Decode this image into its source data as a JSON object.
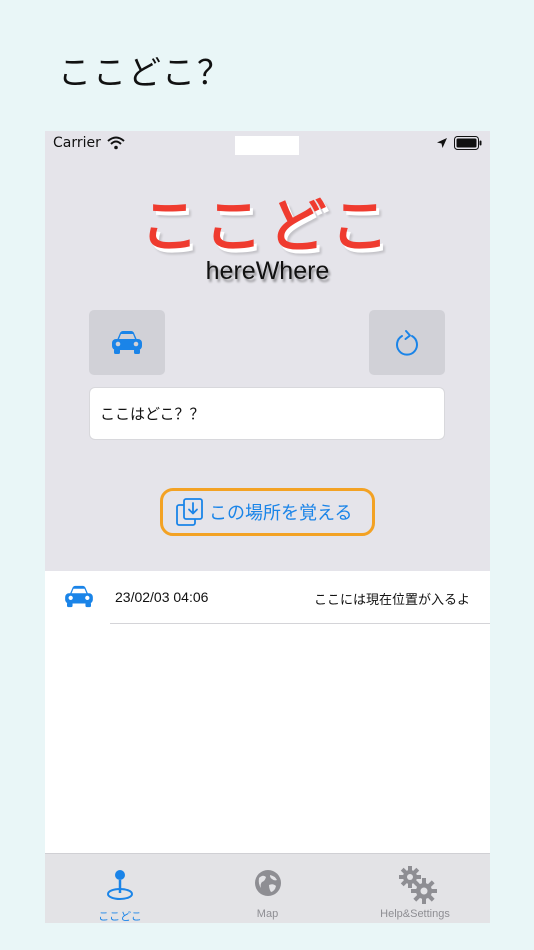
{
  "caption": "ここどこ？",
  "status_bar": {
    "carrier": "Carrier"
  },
  "app": {
    "logo": "ここどこ",
    "subtitle": "hereWhere"
  },
  "location_field": {
    "value": "ここはどこ？？"
  },
  "remember_button": {
    "label": "この場所を覚える"
  },
  "history": [
    {
      "date": "23/02/03 04:06",
      "note": "ここには現在位置が入るよ"
    }
  ],
  "tabs": [
    {
      "label": "ここどこ",
      "active": true
    },
    {
      "label": "Map",
      "active": false
    },
    {
      "label": "Help&Settings",
      "active": false
    }
  ],
  "colors": {
    "accent_blue": "#1a84e8",
    "logo_red": "#ef3b2f",
    "button_orange": "#f3a224",
    "inactive_gray": "#8e8e93"
  }
}
